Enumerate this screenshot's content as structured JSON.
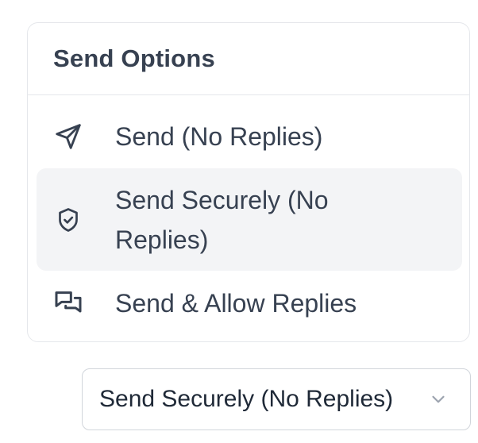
{
  "menu": {
    "title": "Send Options",
    "items": [
      {
        "label": "Send (No Replies)",
        "icon": "paper-plane-icon",
        "selected": false
      },
      {
        "label": "Send Securely (No Replies)",
        "icon": "shield-check-icon",
        "selected": true
      },
      {
        "label": "Send & Allow Replies",
        "icon": "chat-bubbles-icon",
        "selected": false
      }
    ]
  },
  "select": {
    "value": "Send Securely (No Replies)",
    "icon": "chevron-down-icon"
  },
  "colors": {
    "text": "#374151",
    "border": "#e5e7eb",
    "selected_bg": "#f3f4f6",
    "chevron": "#9ca3af"
  }
}
